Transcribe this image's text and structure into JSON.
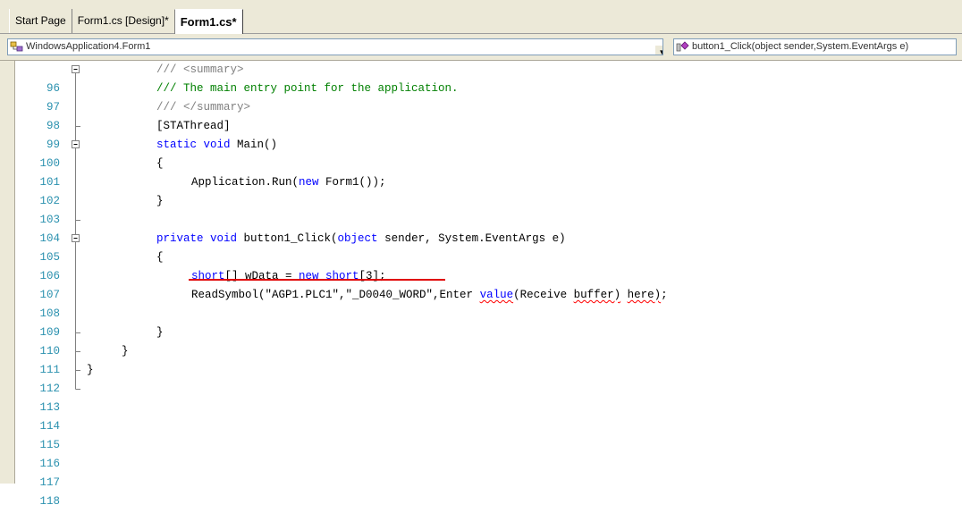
{
  "tabs": [
    {
      "label": "Start Page"
    },
    {
      "label": "Form1.cs [Design]*"
    },
    {
      "label": "Form1.cs*",
      "active": true
    }
  ],
  "navbar": {
    "type_combo": "WindowsApplication4.Form1",
    "member_combo": "button1_Click(object sender,System.EventArgs e)",
    "type_icon": "class-icon",
    "member_icon": "method-icon"
  },
  "editor": {
    "lines": [
      {
        "num": "96",
        "fold": "minus"
      },
      {
        "num": "97",
        "fold": "bar"
      },
      {
        "num": "98",
        "fold": "bar"
      },
      {
        "num": "99",
        "fold": "tick"
      },
      {
        "num": "100",
        "fold": "minus"
      },
      {
        "num": "101",
        "fold": "bar"
      },
      {
        "num": "102",
        "fold": "bar"
      },
      {
        "num": "103",
        "fold": "bar"
      },
      {
        "num": "104",
        "fold": "tick"
      },
      {
        "num": "105",
        "fold": "minus"
      },
      {
        "num": "106",
        "fold": "bar"
      },
      {
        "num": "107",
        "fold": "bar"
      },
      {
        "num": "108",
        "fold": "bar"
      },
      {
        "num": "109",
        "fold": "bar"
      },
      {
        "num": "110",
        "fold": "tick"
      },
      {
        "num": "111",
        "fold": "tick"
      },
      {
        "num": "112",
        "fold": "tick"
      },
      {
        "num": "113",
        "fold": "end"
      },
      {
        "num": "114",
        "fold": "none"
      },
      {
        "num": "115",
        "fold": "none"
      },
      {
        "num": "116",
        "fold": "none"
      },
      {
        "num": "117",
        "fold": "none"
      },
      {
        "num": "118",
        "fold": "none"
      }
    ],
    "code": {
      "l96_prefix": "/// ",
      "l96_tag": "<summary>",
      "l97": "/// The main entry point for the application.",
      "l98_prefix": "/// ",
      "l98_tag": "</summary>",
      "l99": "[STAThread]",
      "l100_kw": "static void",
      "l100_rest": " Main()",
      "l101": "{",
      "l102_a": "Application.Run(",
      "l102_kw": "new",
      "l102_b": " Form1());",
      "l103": "}",
      "l105_kw1": "private void",
      "l105_a": " button1_Click(",
      "l105_kw2": "object",
      "l105_b": " sender, System.EventArgs e)",
      "l106": "{",
      "l107_kw1": "short",
      "l107_a": "[] wData = ",
      "l107_kw2": "new short",
      "l107_b": "[3];",
      "l108_a": "ReadSymbol(\"AGP1.PLC1\",\"_D0040_WORD\",Enter ",
      "l108_err1": "value",
      "l108_b": "(Receive ",
      "l108_err2": "buffer)",
      "l108_c": " ",
      "l108_err3": "here)",
      "l108_d": ";",
      "l110": "}",
      "l111": "}",
      "l112": "}"
    }
  },
  "colors": {
    "keyword": "#0000ff",
    "comment": "#008000",
    "line_number": "#2b91af",
    "error_squiggle": "#ff0000",
    "highlight_underline": "#e00000"
  }
}
